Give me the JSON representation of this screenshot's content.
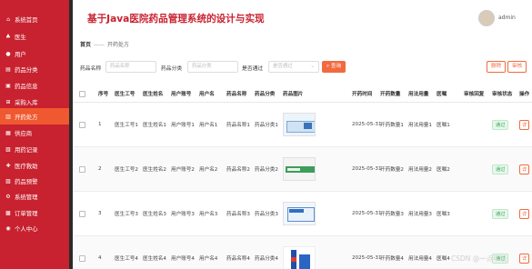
{
  "app": {
    "title": "基于Java医院药品管理系统的设计与实现",
    "user": "admin"
  },
  "sidebar": {
    "items": [
      {
        "label": "系统首页",
        "icon": "home-icon",
        "active": false
      },
      {
        "label": "医生",
        "icon": "doctor-icon",
        "active": false
      },
      {
        "label": "用户",
        "icon": "user-icon",
        "active": false
      },
      {
        "label": "药品分类",
        "icon": "category-icon",
        "active": false
      },
      {
        "label": "药品信息",
        "icon": "medicine-icon",
        "active": false
      },
      {
        "label": "采购入库",
        "icon": "cart-icon",
        "active": false
      },
      {
        "label": "开药处方",
        "icon": "prescription-icon",
        "active": true
      },
      {
        "label": "供应商",
        "icon": "supplier-icon",
        "active": false
      },
      {
        "label": "用药记录",
        "icon": "record-icon",
        "active": false
      },
      {
        "label": "医疗救助",
        "icon": "aid-icon",
        "active": false
      },
      {
        "label": "药品预警",
        "icon": "warning-icon",
        "active": false
      },
      {
        "label": "系统管理",
        "icon": "settings-icon",
        "active": false
      },
      {
        "label": "订单管理",
        "icon": "order-icon",
        "active": false
      },
      {
        "label": "个人中心",
        "icon": "profile-icon",
        "active": false
      }
    ]
  },
  "breadcrumb": {
    "home": "首页",
    "separator": "——",
    "current": "开药处方"
  },
  "filters": {
    "name_label": "药品名称",
    "name_placeholder": "药品名称",
    "category_label": "药品分类",
    "category_placeholder": "药品分类",
    "approve_label": "是否通过",
    "approve_placeholder": "是否通过",
    "search_label": "查询",
    "delete_label": "删除",
    "review_label": "审核"
  },
  "table": {
    "columns": [
      "序号",
      "医生工号",
      "医生姓名",
      "用户账号",
      "用户名",
      "药品名称",
      "药品分类",
      "药品图片",
      "开药时间",
      "开药数量",
      "用法用量",
      "医嘱",
      "审核回复",
      "审核状态",
      "操作"
    ],
    "rows": [
      {
        "no": "1",
        "doc_id": "医生工号1",
        "doc_name": "医生姓名1",
        "acct": "用户账号1",
        "uname": "用户名1",
        "drug": "药品名称1",
        "cat": "药品分类1",
        "time": "2025-05-31",
        "qty": "开药数量1",
        "usage": "用法用量1",
        "advice": "医嘱1",
        "reply": "",
        "status": "通过"
      },
      {
        "no": "2",
        "doc_id": "医生工号2",
        "doc_name": "医生姓名2",
        "acct": "用户账号2",
        "uname": "用户名2",
        "drug": "药品名称2",
        "cat": "药品分类2",
        "time": "2025-05-31",
        "qty": "开药数量2",
        "usage": "用法用量2",
        "advice": "医嘱2",
        "reply": "",
        "status": "通过"
      },
      {
        "no": "3",
        "doc_id": "医生工号3",
        "doc_name": "医生姓名3",
        "acct": "用户账号3",
        "uname": "用户名3",
        "drug": "药品名称3",
        "cat": "药品分类3",
        "time": "2025-05-31",
        "qty": "开药数量3",
        "usage": "用法用量3",
        "advice": "医嘱3",
        "reply": "",
        "status": "通过"
      },
      {
        "no": "4",
        "doc_id": "医生工号4",
        "doc_name": "医生姓名4",
        "acct": "用户账号4",
        "uname": "用户名4",
        "drug": "药品名称4",
        "cat": "药品分类4",
        "time": "2025-05-31",
        "qty": "开药数量4",
        "usage": "用法用量4",
        "advice": "医嘱4",
        "reply": "",
        "status": "通过"
      }
    ],
    "row_action": "详"
  },
  "watermark": "CSDN @一点毕设",
  "colors": {
    "sidebar": "#c8212f",
    "active": "#f0582f",
    "accent": "#f26a3f",
    "pass": "#33a853"
  }
}
